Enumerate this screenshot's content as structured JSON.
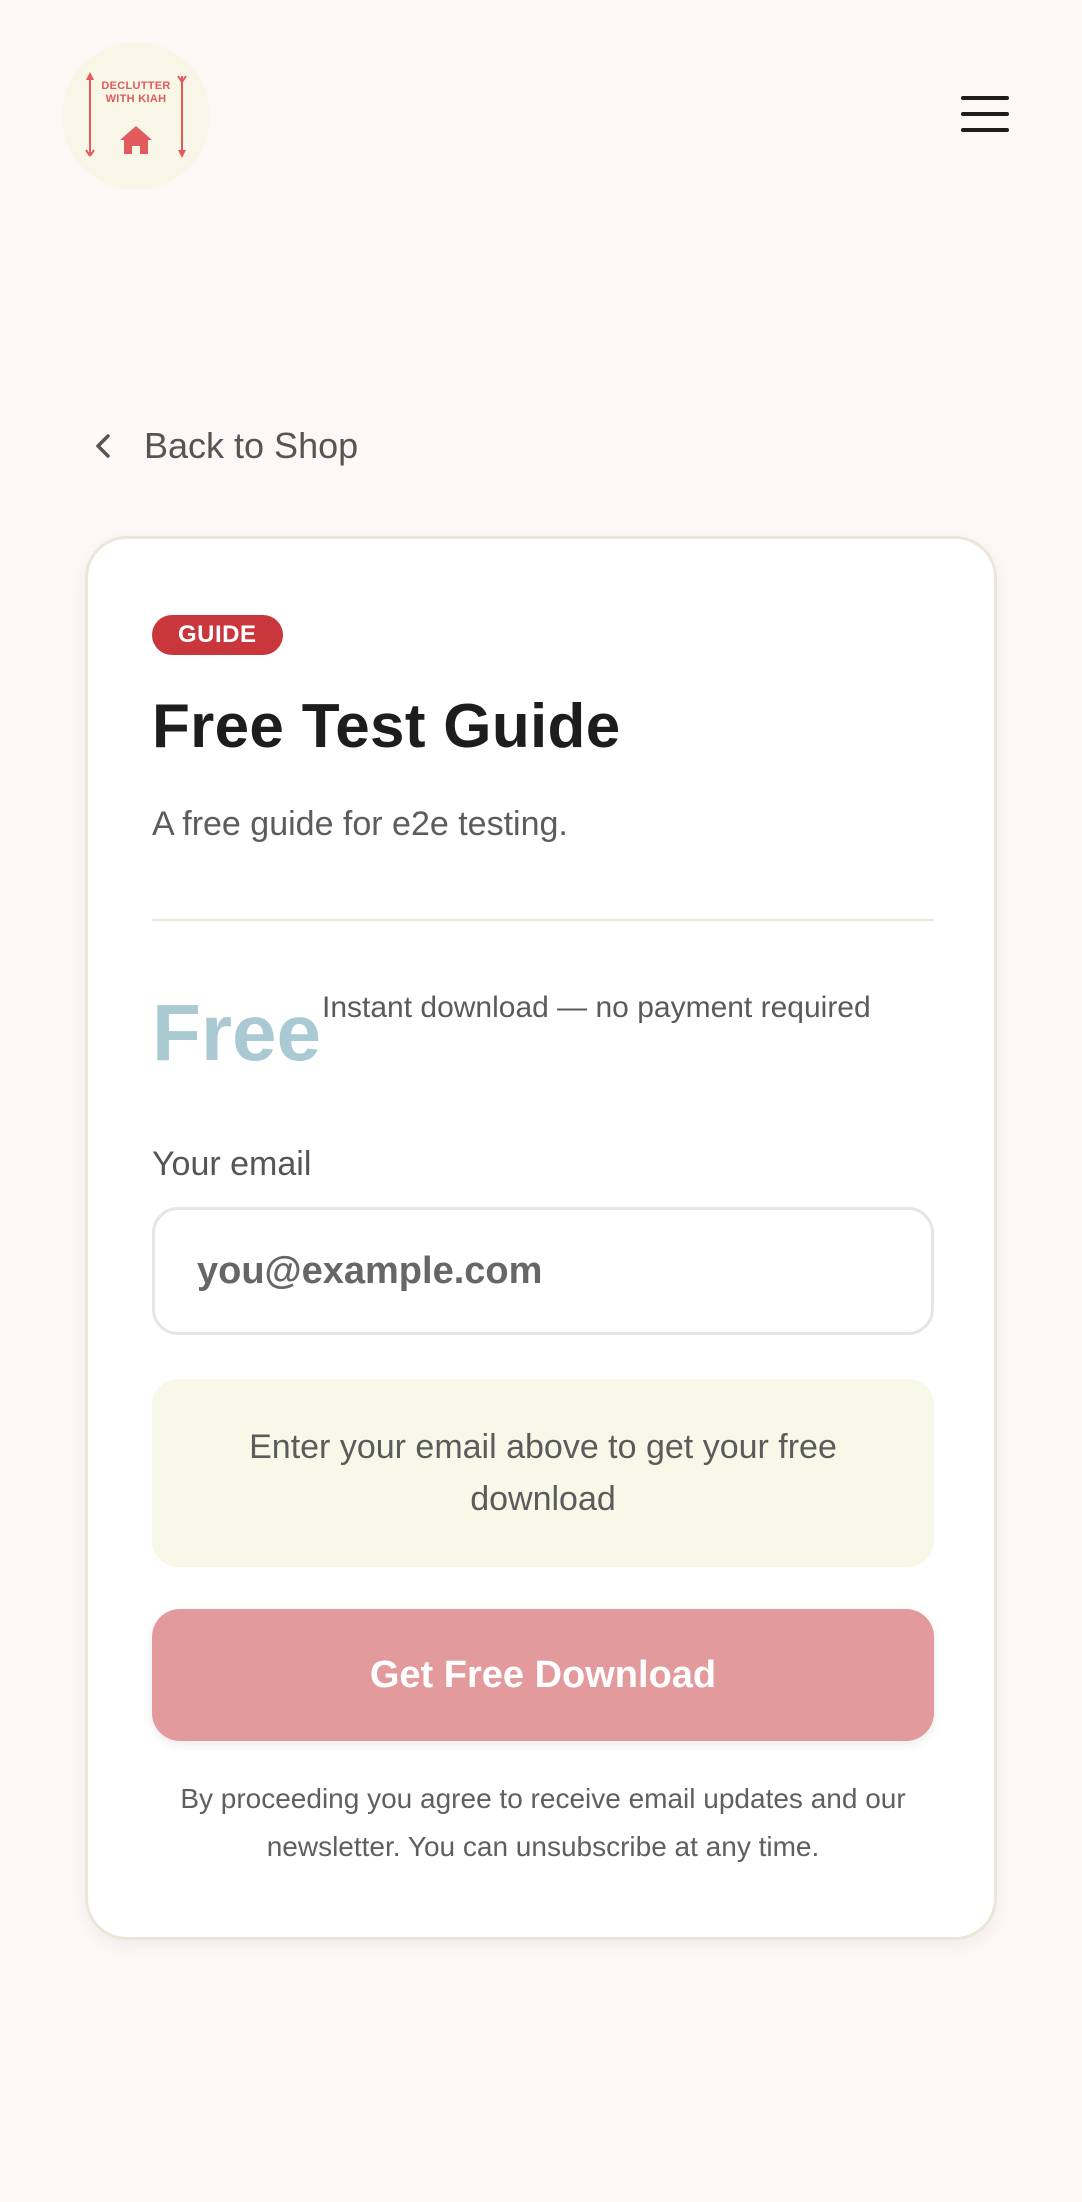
{
  "header": {
    "logo_text": "DECLUTTER WITH KIAH",
    "menu_icon": "hamburger-menu-icon"
  },
  "navigation": {
    "back_label": "Back to Shop",
    "back_icon": "chevron-left-icon"
  },
  "product": {
    "badge": "GUIDE",
    "title": "Free Test Guide",
    "description": "A free guide for e2e testing.",
    "price": "Free",
    "price_note": "Instant download — no payment required"
  },
  "form": {
    "email_label": "Your email",
    "email_placeholder": "you@example.com",
    "email_value": "",
    "notice": "Enter your email above to get your free download",
    "submit_label": "Get Free Download",
    "disclaimer": "By proceeding you agree to receive email updates and our newsletter. You can unsubscribe at any time."
  },
  "colors": {
    "background": "#fdf7f6",
    "brand_red": "#c9373d",
    "button_disabled": "#e39a9c",
    "price_blue": "#a9c9d3",
    "notice_bg": "#f8f8e8"
  }
}
